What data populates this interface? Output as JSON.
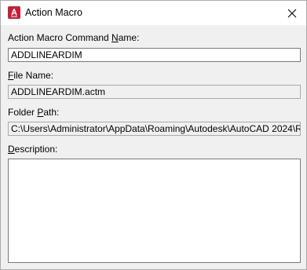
{
  "window": {
    "title": "Action Macro",
    "icon": "autocad-app-icon",
    "icon_color": "#c4203a"
  },
  "fields": {
    "command_name": {
      "label_pre": "Action Macro Command ",
      "label_key": "N",
      "label_post": "ame:",
      "value": "ADDLINEARDIM"
    },
    "file_name": {
      "label_pre": "",
      "label_key": "F",
      "label_post": "ile Name:",
      "value": "ADDLINEARDIM.actm"
    },
    "folder_path": {
      "label_pre": "Folder ",
      "label_key": "P",
      "label_post": "ath:",
      "value": "C:\\Users\\Administrator\\AppData\\Roaming\\Autodesk\\AutoCAD 2024\\R"
    },
    "description": {
      "label_pre": "",
      "label_key": "D",
      "label_post": "escription:",
      "value": ""
    }
  }
}
